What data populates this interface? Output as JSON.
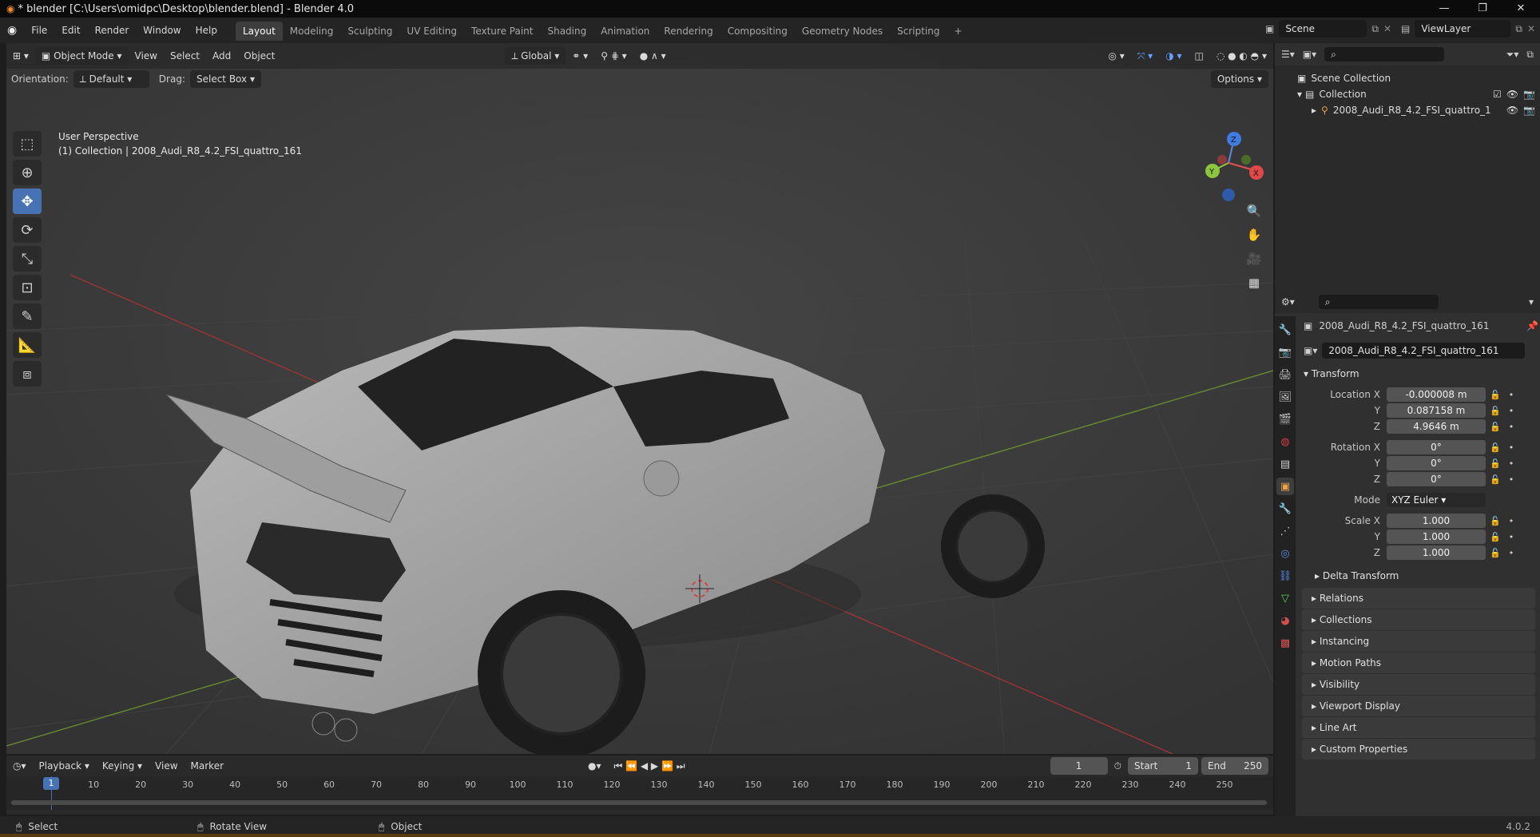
{
  "window": {
    "title": "* blender [C:\\Users\\omidpc\\Desktop\\blender.blend] - Blender 4.0",
    "controls": [
      "—",
      "❐",
      "✕"
    ]
  },
  "menu": [
    "File",
    "Edit",
    "Render",
    "Window",
    "Help"
  ],
  "workspaces": [
    "Layout",
    "Modeling",
    "Sculpting",
    "UV Editing",
    "Texture Paint",
    "Shading",
    "Animation",
    "Rendering",
    "Compositing",
    "Geometry Nodes",
    "Scripting",
    "+"
  ],
  "scene": {
    "name": "Scene",
    "view_layer": "ViewLayer"
  },
  "viewport": {
    "mode": "Object Mode",
    "menus": [
      "View",
      "Select",
      "Add",
      "Object"
    ],
    "transform_orientation": "Global",
    "orientation_label": "Orientation:",
    "orientation_value": "Default",
    "drag_label": "Drag:",
    "drag_value": "Select Box",
    "options": "Options",
    "overlay_line1": "User Perspective",
    "overlay_line2": "(1) Collection | 2008_Audi_R8_4.2_FSI_quattro_161",
    "gizmo_axes": [
      "Z",
      "Y",
      "X"
    ]
  },
  "outliner": {
    "root": "Scene Collection",
    "collection": "Collection",
    "object": "2008_Audi_R8_4.2_FSI_quattro_1"
  },
  "properties": {
    "object_name": "2008_Audi_R8_4.2_FSI_quattro_161",
    "object_field": "2008_Audi_R8_4.2_FSI_quattro_161",
    "transform_title": "Transform",
    "location_label": "Location X",
    "location": [
      "-0.000008 m",
      "0.087158 m",
      "4.9646 m"
    ],
    "rotation_label": "Rotation X",
    "rotation": [
      "0°",
      "0°",
      "0°"
    ],
    "mode_label": "Mode",
    "mode_value": "XYZ Euler",
    "scale_label": "Scale X",
    "scale": [
      "1.000",
      "1.000",
      "1.000"
    ],
    "axis_y": "Y",
    "axis_z": "Z",
    "delta_transform": "Delta Transform",
    "panels": [
      "Relations",
      "Collections",
      "Instancing",
      "Motion Paths",
      "Visibility",
      "Viewport Display",
      "Line Art",
      "Custom Properties"
    ]
  },
  "timeline": {
    "menus": [
      "Playback",
      "Keying",
      "View",
      "Marker"
    ],
    "current_frame": "1",
    "start_label": "Start",
    "start": "1",
    "end_label": "End",
    "end": "250",
    "ticks": [
      "1",
      "10",
      "20",
      "30",
      "40",
      "50",
      "60",
      "70",
      "80",
      "90",
      "100",
      "110",
      "120",
      "130",
      "140",
      "150",
      "160",
      "170",
      "180",
      "190",
      "200",
      "210",
      "220",
      "230",
      "240",
      "250"
    ]
  },
  "status": {
    "select": "Select",
    "rotate": "Rotate View",
    "object": "Object",
    "version": "4.0.2"
  }
}
